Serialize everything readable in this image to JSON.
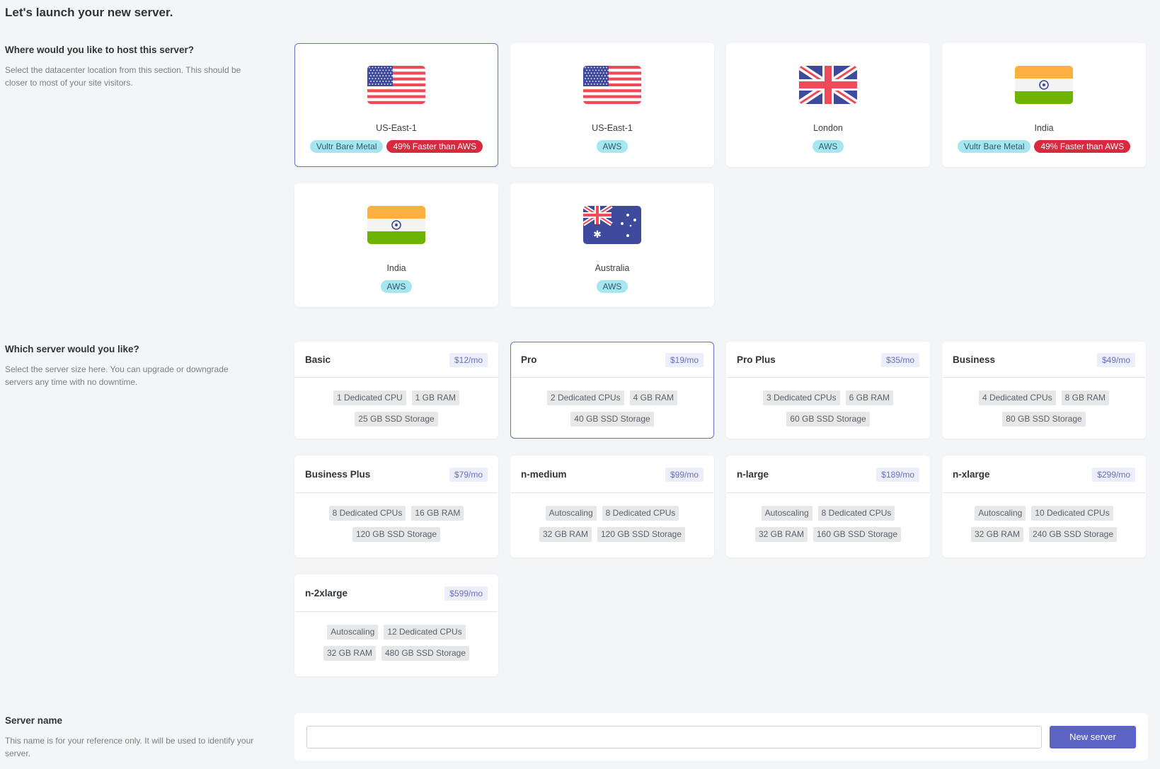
{
  "page_title": "Let's launch your new server.",
  "location_section": {
    "title": "Where would you like to host this server?",
    "description": "Select the datacenter location from this section. This should be closer to most of your site visitors.",
    "locations": [
      {
        "name": "US-East-1",
        "flag": "us-flag-icon",
        "badges": [
          "Vultr Bare Metal",
          "49% Faster than AWS"
        ],
        "selected": true
      },
      {
        "name": "US-East-1",
        "flag": "us-flag-icon",
        "badges": [
          "AWS"
        ],
        "selected": false
      },
      {
        "name": "London",
        "flag": "uk-flag-icon",
        "badges": [
          "AWS"
        ],
        "selected": false
      },
      {
        "name": "India",
        "flag": "india-flag-icon",
        "badges": [
          "Vultr Bare Metal",
          "49% Faster than AWS"
        ],
        "selected": false
      },
      {
        "name": "India",
        "flag": "india-flag-icon",
        "badges": [
          "AWS"
        ],
        "selected": false
      },
      {
        "name": "Australia",
        "flag": "australia-flag-icon",
        "badges": [
          "AWS"
        ],
        "selected": false
      }
    ]
  },
  "server_section": {
    "title": "Which server would you like?",
    "description": "Select the server size here. You can upgrade or downgrade servers any time with no downtime.",
    "plans": [
      {
        "name": "Basic",
        "price": "$12/mo",
        "specs": [
          "1 Dedicated CPU",
          "1 GB RAM",
          "25 GB SSD Storage"
        ],
        "selected": false
      },
      {
        "name": "Pro",
        "price": "$19/mo",
        "specs": [
          "2 Dedicated CPUs",
          "4 GB RAM",
          "40 GB SSD Storage"
        ],
        "selected": true
      },
      {
        "name": "Pro Plus",
        "price": "$35/mo",
        "specs": [
          "3 Dedicated CPUs",
          "6 GB RAM",
          "60 GB SSD Storage"
        ],
        "selected": false
      },
      {
        "name": "Business",
        "price": "$49/mo",
        "specs": [
          "4 Dedicated CPUs",
          "8 GB RAM",
          "80 GB SSD Storage"
        ],
        "selected": false
      },
      {
        "name": "Business Plus",
        "price": "$79/mo",
        "specs": [
          "8 Dedicated CPUs",
          "16 GB RAM",
          "120 GB SSD Storage"
        ],
        "selected": false
      },
      {
        "name": "n-medium",
        "price": "$99/mo",
        "specs": [
          "Autoscaling",
          "8 Dedicated CPUs",
          "32 GB RAM",
          "120 GB SSD Storage"
        ],
        "selected": false
      },
      {
        "name": "n-large",
        "price": "$189/mo",
        "specs": [
          "Autoscaling",
          "8 Dedicated CPUs",
          "32 GB RAM",
          "160 GB SSD Storage"
        ],
        "selected": false
      },
      {
        "name": "n-xlarge",
        "price": "$299/mo",
        "specs": [
          "Autoscaling",
          "10 Dedicated CPUs",
          "32 GB RAM",
          "240 GB SSD Storage"
        ],
        "selected": false
      },
      {
        "name": "n-2xlarge",
        "price": "$599/mo",
        "specs": [
          "Autoscaling",
          "12 Dedicated CPUs",
          "32 GB RAM",
          "480 GB SSD Storage"
        ],
        "selected": false
      }
    ]
  },
  "name_section": {
    "title": "Server name",
    "description": "This name is for your reference only. It will be used to identify your server.",
    "input_value": "",
    "input_placeholder": "",
    "submit_label": "New server"
  },
  "colors": {
    "accent": "#5b64c4",
    "selected_border": "#6b72c9",
    "provider_badge": "#a6e6f0",
    "speed_badge": "#d9293f"
  }
}
